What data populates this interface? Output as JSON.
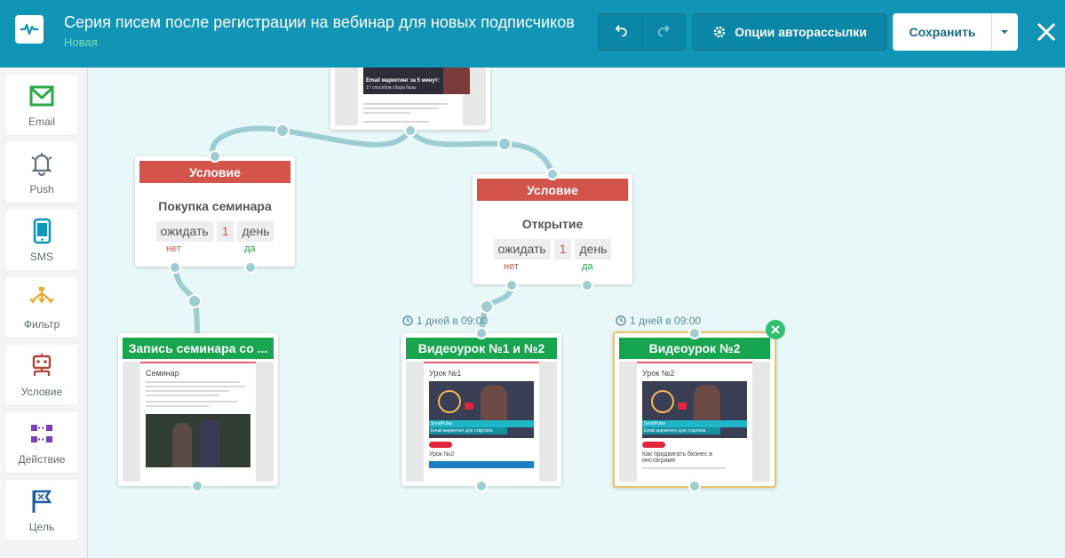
{
  "header": {
    "title": "Серия писем после регистрации на вебинар для новых подписчиков",
    "status": "Новая",
    "options_label": "Опции авторассылки",
    "save_label": "Сохранить"
  },
  "sidebar": {
    "items": [
      {
        "label": "Email",
        "icon": "envelope-icon",
        "color": "#2aa84a"
      },
      {
        "label": "Push",
        "icon": "bell-icon",
        "color": "#5f7180"
      },
      {
        "label": "SMS",
        "icon": "phone-icon",
        "color": "#1195b6"
      },
      {
        "label": "Фильтр",
        "icon": "filter-icon",
        "color": "#f0a830"
      },
      {
        "label": "Условие",
        "icon": "condition-icon",
        "color": "#b0433a"
      },
      {
        "label": "Действие",
        "icon": "action-icon",
        "color": "#7b3fb8"
      },
      {
        "label": "Цель",
        "icon": "flag-icon",
        "color": "#1c5fa6"
      }
    ]
  },
  "canvas": {
    "top_email": {
      "preview_title": "Email маркетинг за 5 минут:",
      "preview_sub": "17 способов сбора базы"
    },
    "conditions": [
      {
        "header": "Условие",
        "name": "Покупка семинара",
        "wait": "ожидать",
        "count": "1",
        "unit": "день",
        "no": "нет",
        "yes": "да"
      },
      {
        "header": "Условие",
        "name": "Открытие",
        "wait": "ожидать",
        "count": "1",
        "unit": "день",
        "no": "нет",
        "yes": "да"
      }
    ],
    "emails": [
      {
        "header": "Запись семинара со ...",
        "doc_title": "Семинар"
      },
      {
        "header": "Видеоурок №1 и №2",
        "timer": "1 дней в 09:00",
        "doc_title": "Урок №1",
        "doc_sub": "Урок №2",
        "brand": "SendPulse",
        "banner": "Email маркетинг для стартапа"
      },
      {
        "header": "Видеоурок №2",
        "timer": "1 дней в 09:00",
        "doc_title": "Урок №2",
        "doc_sub": "Как продвигать бизнес в инстаграме",
        "brand": "SendPulse",
        "banner": "Email маркетинг для стартапа"
      }
    ]
  },
  "colors": {
    "header_bg": "#1195b6",
    "condition": "#d2544a",
    "email": "#17a64f",
    "connector": "#9ecdd1"
  }
}
